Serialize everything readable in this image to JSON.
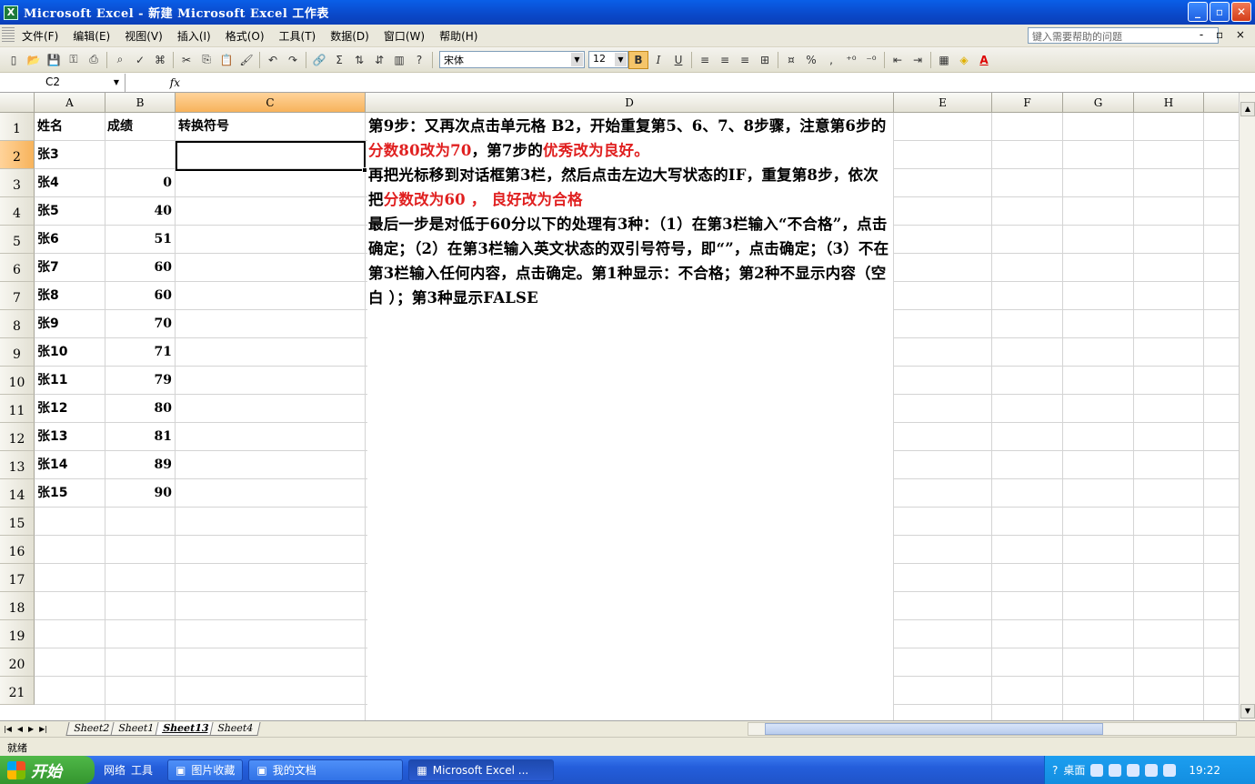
{
  "window": {
    "title": "Microsoft Excel - 新建 Microsoft Excel 工作表",
    "min": "_",
    "max": "▫",
    "close": "✕"
  },
  "menu": {
    "items": [
      "文件(F)",
      "编辑(E)",
      "视图(V)",
      "插入(I)",
      "格式(O)",
      "工具(T)",
      "数据(D)",
      "窗口(W)",
      "帮助(H)"
    ],
    "help_placeholder": "键入需要帮助的问题",
    "controls": "- ▫ ×"
  },
  "toolbar": {
    "font": "宋体",
    "size": "12",
    "bold": "B",
    "italic": "I",
    "underline": "U",
    "sum": "Σ",
    "percent": "%",
    "font_color": "A"
  },
  "formula_bar": {
    "name_box": "C2",
    "fx": "fx",
    "content": ""
  },
  "columns": [
    "A",
    "B",
    "C",
    "D",
    "E",
    "F",
    "G",
    "H"
  ],
  "rows": [
    "1",
    "2",
    "3",
    "4",
    "5",
    "6",
    "7",
    "8",
    "9",
    "10",
    "11",
    "12",
    "13",
    "14",
    "15",
    "16",
    "17",
    "18",
    "19",
    "20",
    "21"
  ],
  "cells": {
    "A": [
      "姓名",
      "张3",
      "张4",
      "张5",
      "张6",
      "张7",
      "张8",
      "张9",
      "张10",
      "张11",
      "张12",
      "张13",
      "张14",
      "张15"
    ],
    "B": [
      "成绩",
      "",
      "0",
      "40",
      "51",
      "60",
      "60",
      "70",
      "71",
      "79",
      "80",
      "81",
      "89",
      "90"
    ],
    "C1": "转换符号"
  },
  "note": {
    "p1a": "第9步：又再次点击单元格 B2，开始重复第5、6、7、8步骤，注意第6步的",
    "p1b": "分数80改为70",
    "p1c": "，第7步的",
    "p1d": "优秀改为良好。",
    "p2a": "再把光标移到对话框第3栏，然后点击左边大写状态的IF，重复第8步，依次把",
    "p2b": "分数改为60 ， 良好改为合格",
    "p3": "最后一步是对低于60分以下的处理有3种：（1）在第3栏输入“不合格”，点击确定；（2）在第3栏输入英文状态的双引号符号，即“”，点击确定；（3）不在第3栏输入任何内容，点击确定。第1种显示：不合格；第2种不显示内容（空白 ）；第3种显示FALSE"
  },
  "sheets": [
    "Sheet2",
    "Sheet1",
    "Sheet13",
    "Sheet4"
  ],
  "active_sheet": "Sheet13",
  "status": "就绪",
  "taskbar": {
    "start": "开始",
    "quick": [
      "网络",
      "工具"
    ],
    "tasks": [
      "图片收藏",
      "我的文档",
      "Microsoft Excel ..."
    ],
    "tray_label": "桌面",
    "time": "19:22"
  }
}
